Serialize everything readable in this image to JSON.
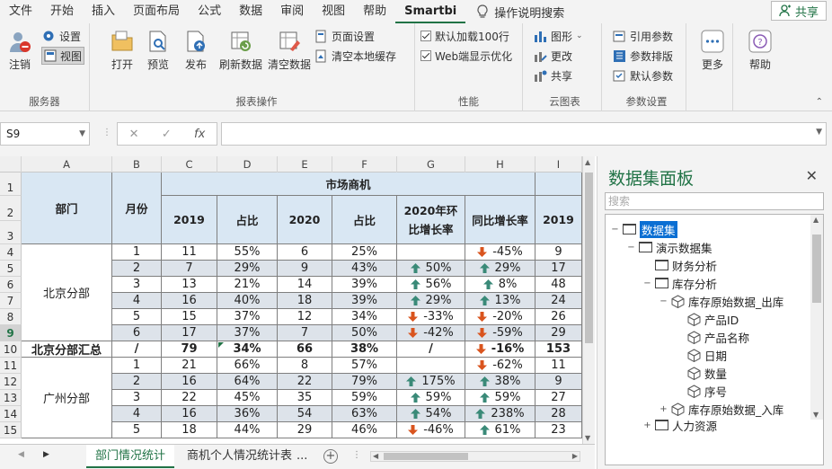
{
  "menu": {
    "tabs": [
      "文件",
      "开始",
      "插入",
      "页面布局",
      "公式",
      "数据",
      "审阅",
      "视图",
      "帮助",
      "Smartbi"
    ],
    "active": "Smartbi",
    "help_search": "操作说明搜索",
    "share": "共享"
  },
  "ribbon": {
    "service": {
      "logout": "注销",
      "settings": "设置",
      "view": "视图",
      "label": "服务器"
    },
    "report": {
      "open": "打开",
      "preview": "预览",
      "publish": "发布",
      "refresh": "刷新数据",
      "clear": "清空数据",
      "page_setup": "页面设置",
      "clear_cache": "清空本地缓存",
      "label": "报表操作"
    },
    "performance": {
      "auto_load": "默认加载100行",
      "web_opt": "Web端显示优化",
      "label": "性能"
    },
    "cloud": {
      "chart": "图形",
      "modify": "更改",
      "share": "共享",
      "label": "云图表"
    },
    "params": {
      "ref": "引用参数",
      "layout": "参数排版",
      "default": "默认参数",
      "label": "参数设置"
    },
    "more": "更多",
    "help": "帮助"
  },
  "formula_bar": {
    "name_box": "S9",
    "fx": "fx",
    "value": ""
  },
  "grid": {
    "columns": [
      "A",
      "B",
      "C",
      "D",
      "E",
      "F",
      "G",
      "H",
      "I"
    ],
    "rows": [
      "1",
      "2",
      "3",
      "4",
      "5",
      "6",
      "7",
      "8",
      "9",
      "10",
      "11",
      "12",
      "13",
      "14",
      "15"
    ],
    "selected_row": "9",
    "header": {
      "dept": "部门",
      "month": "月份",
      "market": "市场商机",
      "c2019": "2019",
      "share1": "占比",
      "c2020": "2020",
      "share2": "占比",
      "mom": "2020年环比增长率",
      "yoy": "同比增长率",
      "c2019b": "2019"
    },
    "beijing": "北京分部",
    "guangzhou": "广州分部",
    "beijing_total": "北京分部汇总",
    "data": [
      {
        "m": "1",
        "c": "11",
        "d": "55%",
        "e": "6",
        "f": "25%",
        "g": "",
        "gd": "",
        "h": "-45%",
        "hd": "down",
        "i": "9"
      },
      {
        "m": "2",
        "c": "7",
        "d": "29%",
        "e": "9",
        "f": "43%",
        "g": "50%",
        "gd": "up",
        "h": "29%",
        "hd": "up",
        "i": "17"
      },
      {
        "m": "3",
        "c": "13",
        "d": "21%",
        "e": "14",
        "f": "39%",
        "g": "56%",
        "gd": "up",
        "h": "8%",
        "hd": "up",
        "i": "48"
      },
      {
        "m": "4",
        "c": "16",
        "d": "40%",
        "e": "18",
        "f": "39%",
        "g": "29%",
        "gd": "up",
        "h": "13%",
        "hd": "up",
        "i": "24"
      },
      {
        "m": "5",
        "c": "15",
        "d": "37%",
        "e": "12",
        "f": "34%",
        "g": "-33%",
        "gd": "down",
        "h": "-20%",
        "hd": "down",
        "i": "26"
      },
      {
        "m": "6",
        "c": "17",
        "d": "37%",
        "e": "7",
        "f": "50%",
        "g": "-42%",
        "gd": "down",
        "h": "-59%",
        "hd": "down",
        "i": "29"
      },
      {
        "m": "/",
        "c": "79",
        "d": "34%",
        "e": "66",
        "f": "38%",
        "g": "/",
        "gd": "",
        "h": "-16%",
        "hd": "down",
        "i": "153"
      },
      {
        "m": "1",
        "c": "21",
        "d": "66%",
        "e": "8",
        "f": "57%",
        "g": "",
        "gd": "",
        "h": "-62%",
        "hd": "down",
        "i": "11"
      },
      {
        "m": "2",
        "c": "16",
        "d": "64%",
        "e": "22",
        "f": "79%",
        "g": "175%",
        "gd": "up",
        "h": "38%",
        "hd": "up",
        "i": "9"
      },
      {
        "m": "3",
        "c": "22",
        "d": "45%",
        "e": "35",
        "f": "59%",
        "g": "59%",
        "gd": "up",
        "h": "59%",
        "hd": "up",
        "i": "27"
      },
      {
        "m": "4",
        "c": "16",
        "d": "36%",
        "e": "54",
        "f": "63%",
        "g": "54%",
        "gd": "up",
        "h": "238%",
        "hd": "up",
        "i": "28"
      },
      {
        "m": "5",
        "c": "18",
        "d": "44%",
        "e": "29",
        "f": "46%",
        "g": "-46%",
        "gd": "down",
        "h": "61%",
        "hd": "up",
        "i": "23"
      }
    ]
  },
  "sheets": {
    "active": "部门情况统计",
    "other": "商机个人情况统计表",
    "more": "..."
  },
  "panel": {
    "title": "数据集面板",
    "search_placeholder": "搜索",
    "tree": {
      "root": "数据集",
      "demo": "演示数据集",
      "finance": "财务分析",
      "inventory": "库存分析",
      "out": "库存原始数据_出库",
      "f1": "产品ID",
      "f2": "产品名称",
      "f3": "日期",
      "f4": "数量",
      "f5": "序号",
      "in": "库存原始数据_入库",
      "hr": "人力资源"
    }
  },
  "colors": {
    "accent": "#217346",
    "header_fill": "#d9e7f3",
    "alt_fill": "#dde3ea",
    "up": "#3a8a78",
    "down": "#d9541e"
  }
}
